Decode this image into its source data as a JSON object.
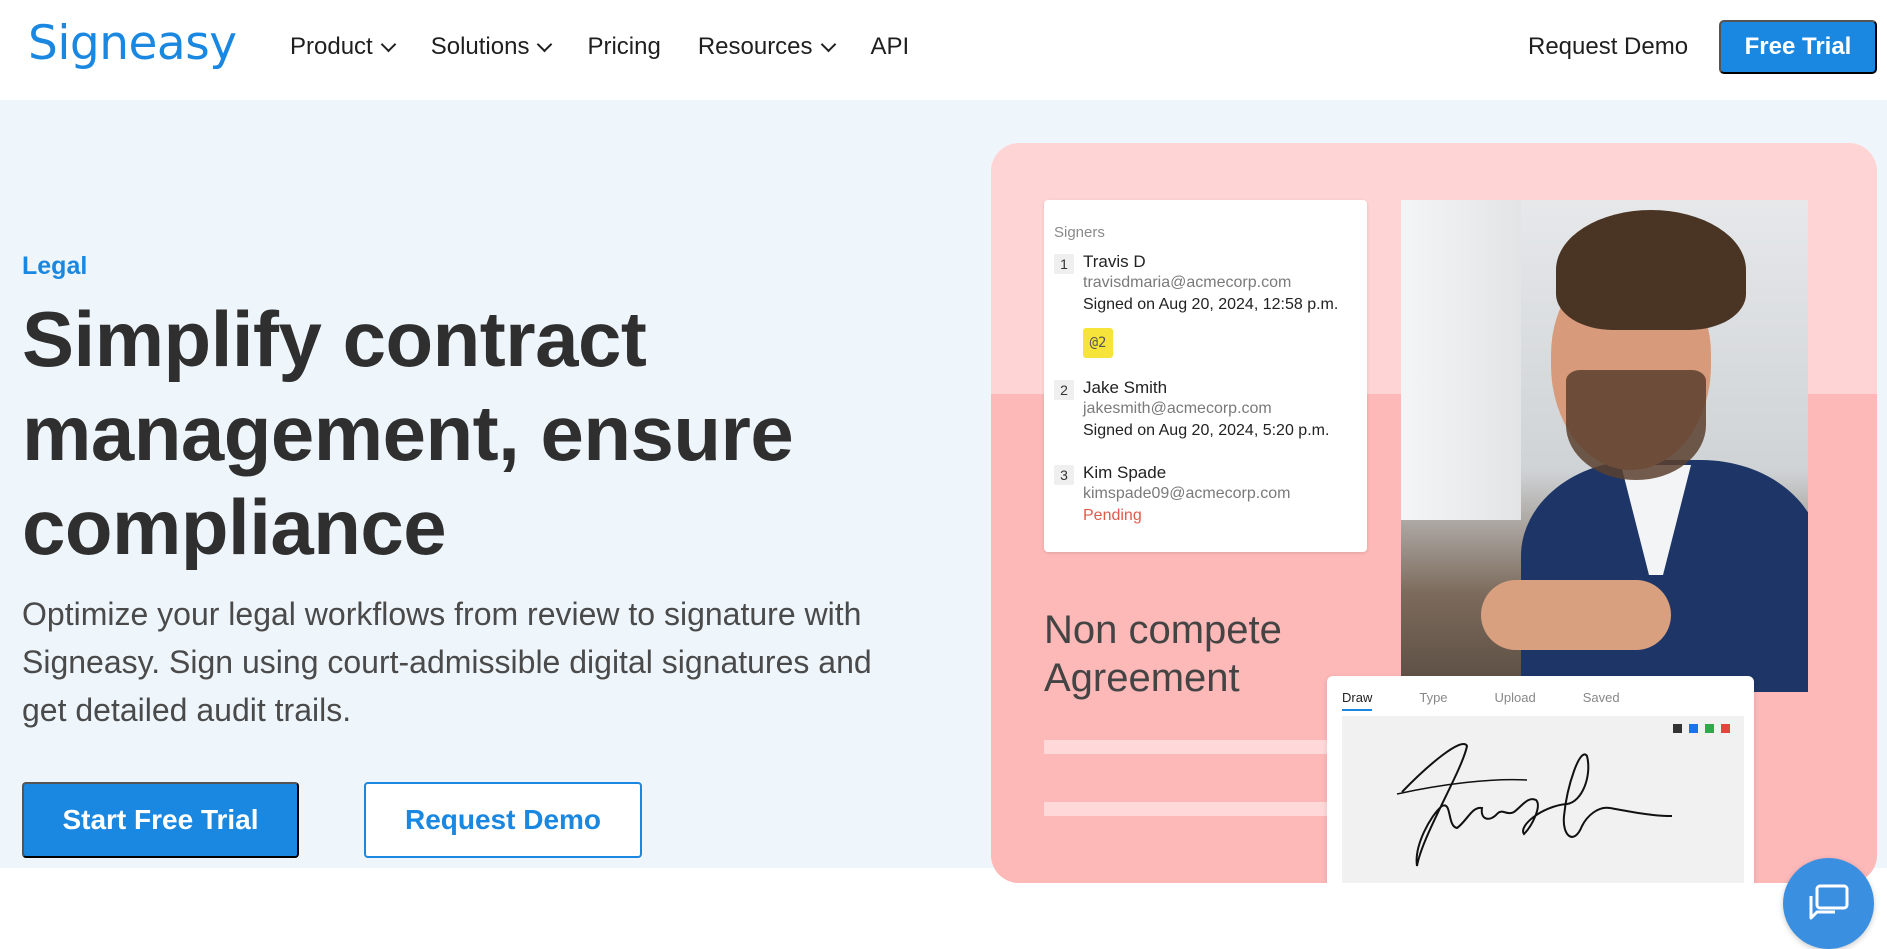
{
  "header": {
    "logo": "Signeasy",
    "nav": [
      {
        "label": "Product",
        "dropdown": true
      },
      {
        "label": "Solutions",
        "dropdown": true
      },
      {
        "label": "Pricing",
        "dropdown": false
      },
      {
        "label": "Resources",
        "dropdown": true
      },
      {
        "label": "API",
        "dropdown": false
      }
    ],
    "request_demo": "Request Demo",
    "free_trial": "Free Trial"
  },
  "hero": {
    "eyebrow": "Legal",
    "headline": "Simplify contract management, ensure compliance",
    "subtext": "Optimize your legal workflows from review to signature with Signeasy. Sign using court-admissible digital signatures and get detailed audit trails.",
    "cta_primary": "Start Free Trial",
    "cta_secondary": "Request Demo"
  },
  "illustration": {
    "signers_title": "Signers",
    "signers": [
      {
        "num": "1",
        "name": "Travis D",
        "email": "travisdmaria@acmecorp.com",
        "status": "Signed on Aug 20, 2024, 12:58 p.m.",
        "pending": false,
        "tag": "@2"
      },
      {
        "num": "2",
        "name": "Jake Smith",
        "email": "jakesmith@acmecorp.com",
        "status": "Signed on Aug 20, 2024, 5:20 p.m.",
        "pending": false
      },
      {
        "num": "3",
        "name": "Kim Spade",
        "email": "kimspade09@acmecorp.com",
        "status": "Pending",
        "pending": true
      }
    ],
    "doc_title": "Non compete Agreement",
    "signature_tabs": [
      "Draw",
      "Type",
      "Upload",
      "Saved"
    ],
    "active_tab": "Draw",
    "swatch_colors": [
      "#333333",
      "#1a73e8",
      "#2eaa4a",
      "#e0463d"
    ],
    "colors": {
      "accent": "#1a87e0",
      "panel_top": "#ffd4d4",
      "panel_bottom": "#fdb8b8",
      "pending": "#e05a4c",
      "tag": "#f7e43a"
    }
  },
  "chat": {
    "icon": "chat-icon"
  }
}
